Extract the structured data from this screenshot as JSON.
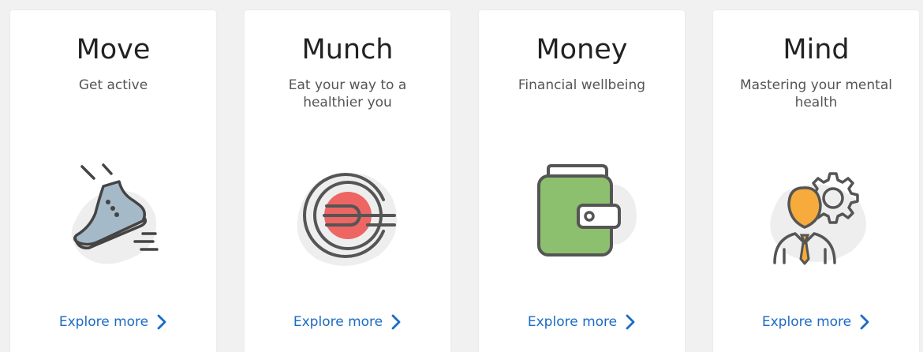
{
  "accent_color": "#1a6bc4",
  "cards": [
    {
      "title": "Move",
      "subtitle": "Get active",
      "link_label": "Explore more",
      "icon": "sneaker-icon"
    },
    {
      "title": "Munch",
      "subtitle": "Eat your way to a healthier you",
      "link_label": "Explore more",
      "icon": "plate-fork-icon"
    },
    {
      "title": "Money",
      "subtitle": "Financial wellbeing",
      "link_label": "Explore more",
      "icon": "wallet-icon"
    },
    {
      "title": "Mind",
      "subtitle": "Mastering your mental health",
      "link_label": "Explore more",
      "icon": "person-gear-icon"
    }
  ]
}
